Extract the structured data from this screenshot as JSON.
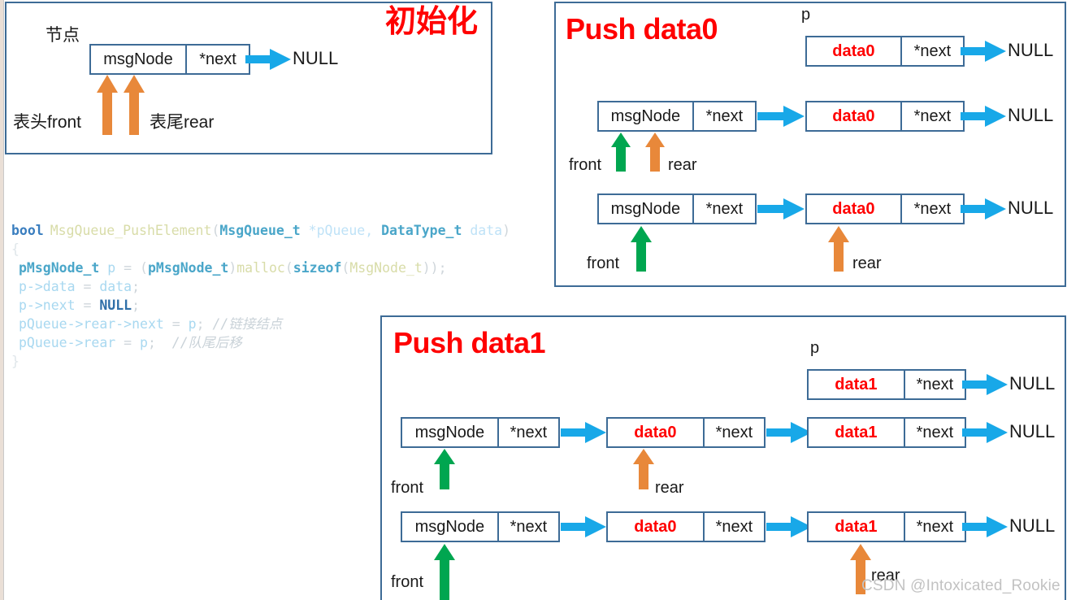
{
  "meta": {
    "watermark": "CSDN @Intoxicated_Rookie",
    "colors": {
      "box_border": "#3d6b96",
      "title_red": "#ff0000",
      "data_red": "#ff0000",
      "arrow_blue": "#18a8e8",
      "arrow_orange": "#e8883a",
      "arrow_green": "#00a650",
      "panel_border": "#3d6b96",
      "code_bg": "#ffffff"
    }
  },
  "panel_init": {
    "title": "初始化",
    "node_label": "节点",
    "front_label": "表头front",
    "rear_label": "表尾rear",
    "node": {
      "left": "msgNode",
      "right": "*next"
    },
    "null_label": "NULL"
  },
  "code": {
    "lines": [
      "bool MsgQueue_PushElement(MsgQueue_t *pQueue, DataType_t data)",
      "{",
      " pMsgNode_t p = (pMsgNode_t)malloc(sizeof(MsgNode_t));",
      " p->data = data;",
      " p->next = NULL;",
      " pQueue->rear->next = p; //链接结点",
      " pQueue->rear = p;  //队尾后移",
      "}"
    ],
    "tokens": {
      "l0": {
        "bool": "bool",
        "fn": "MsgQueue_PushElement",
        "p1": "(",
        "t1": "MsgQueue_t",
        "s1": " *pQueue, ",
        "t2": "DataType_t",
        "s2": " data",
        "p2": ")"
      },
      "l1": "{",
      "l2": {
        "t": "pMsgNode_t",
        "v": " p ",
        "eq": "= ",
        "p1": "(",
        "t2": "pMsgNode_t",
        "p2": ")",
        "call": "malloc",
        "p3": "(",
        "sz": "sizeof",
        "p4": "(",
        "t3": "MsgNode_t",
        "p5": "));"
      },
      "l3": {
        "v": "p->data",
        "eq": " = ",
        "v2": "data",
        "t": ";"
      },
      "l4": {
        "v": "p->next",
        "eq": " = ",
        "null": "NULL",
        "t": ";"
      },
      "l5": {
        "v": "pQueue->rear->next",
        "eq": " = ",
        "v2": "p",
        "t": "; ",
        "c": "//链接结点"
      },
      "l6": {
        "v": "pQueue->rear",
        "eq": " = ",
        "v2": "p",
        "t": ";  ",
        "c": "//队尾后移"
      },
      "l7": "}"
    }
  },
  "panel_push0": {
    "title": "Push data0",
    "p_label": "p",
    "rows": [
      {
        "name": "row-p-node",
        "nodes": [
          {
            "left": "data0",
            "right": "*next",
            "data": true
          }
        ],
        "null_label": "NULL"
      },
      {
        "name": "row-before-link",
        "nodes": [
          {
            "left": "msgNode",
            "right": "*next",
            "data": false
          },
          {
            "left": "data0",
            "right": "*next",
            "data": true
          }
        ],
        "null_label": "NULL",
        "front_label": "front",
        "rear_label": "rear"
      },
      {
        "name": "row-after-link",
        "nodes": [
          {
            "left": "msgNode",
            "right": "*next",
            "data": false
          },
          {
            "left": "data0",
            "right": "*next",
            "data": true
          }
        ],
        "null_label": "NULL",
        "front_label": "front",
        "rear_label": "rear"
      }
    ]
  },
  "panel_push1": {
    "title": "Push data1",
    "p_label": "p",
    "rows": [
      {
        "name": "row-p-node",
        "nodes": [
          {
            "left": "data1",
            "right": "*next",
            "data": true
          }
        ],
        "null_label": "NULL"
      },
      {
        "name": "row-before-link",
        "nodes": [
          {
            "left": "msgNode",
            "right": "*next",
            "data": false
          },
          {
            "left": "data0",
            "right": "*next",
            "data": true
          },
          {
            "left": "data1",
            "right": "*next",
            "data": true
          }
        ],
        "null_label": "NULL",
        "front_label": "front",
        "rear_label": "rear"
      },
      {
        "name": "row-after-link",
        "nodes": [
          {
            "left": "msgNode",
            "right": "*next",
            "data": false
          },
          {
            "left": "data0",
            "right": "*next",
            "data": true
          },
          {
            "left": "data1",
            "right": "*next",
            "data": true
          }
        ],
        "null_label": "NULL",
        "front_label": "front",
        "rear_label": "rear"
      }
    ]
  }
}
